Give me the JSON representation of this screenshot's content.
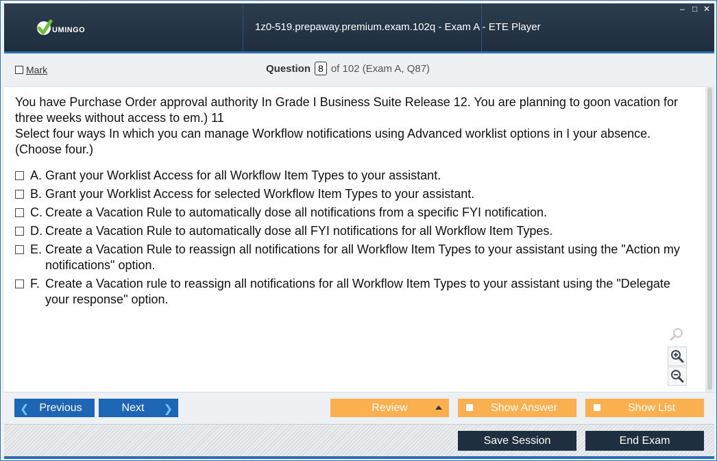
{
  "window": {
    "title": "1z0-519.prepaway.premium.exam.102q - Exam A - ETE Player",
    "logo_text": "UMINGO",
    "controls": [
      "–",
      "□",
      "✕"
    ]
  },
  "toolbar": {
    "mark_label": "Mark",
    "question_label": "Question",
    "question_number": "8",
    "question_of": "of 102 (Exam A, Q87)"
  },
  "question": {
    "paragraphs": [
      "You have Purchase Order approval authority In Grade I Business Suite Release 12. You are planning to goon vacation for three weeks without access to em.) 11",
      "Select four ways In which you can manage Workflow notifications using Advanced worklist options in I your absence. (Choose four.)"
    ],
    "options": [
      {
        "letter": "A.",
        "text": "Grant your Worklist Access for all Workflow Item Types to your assistant."
      },
      {
        "letter": "B.",
        "text": "Grant your Worklist Access for selected Workflow Item Types to your assistant."
      },
      {
        "letter": "C.",
        "text": "Create a Vacation Rule to automatically dose all notifications from a specific FYI notification."
      },
      {
        "letter": "D.",
        "text": "Create a Vacation Rule to automatically dose all FYI notifications for all Workflow Item Types."
      },
      {
        "letter": "E.",
        "text": "Create a Vacation Rule to reassign all notifications for all Workflow Item Types to your assistant using the \"Action my notifications\" option."
      },
      {
        "letter": "F.",
        "text": "Create a Vacation rule to reassign all notifications for all Workflow Item Types to your assistant using the \"Delegate your response\" option."
      }
    ]
  },
  "zoom": {
    "icons": [
      "search-icon",
      "zoom-in-icon",
      "zoom-out-icon"
    ]
  },
  "nav": {
    "previous": "Previous",
    "next": "Next",
    "review": "Review",
    "show_answer": "Show Answer",
    "show_list": "Show List",
    "save_session": "Save Session",
    "end_exam": "End Exam"
  },
  "colors": {
    "title_bg": "#23354a",
    "accent_blue": "#1d66b6",
    "orange": "#fbb04f",
    "dark_button": "#1f2f3f",
    "logo_green": "#6bbf3a"
  }
}
